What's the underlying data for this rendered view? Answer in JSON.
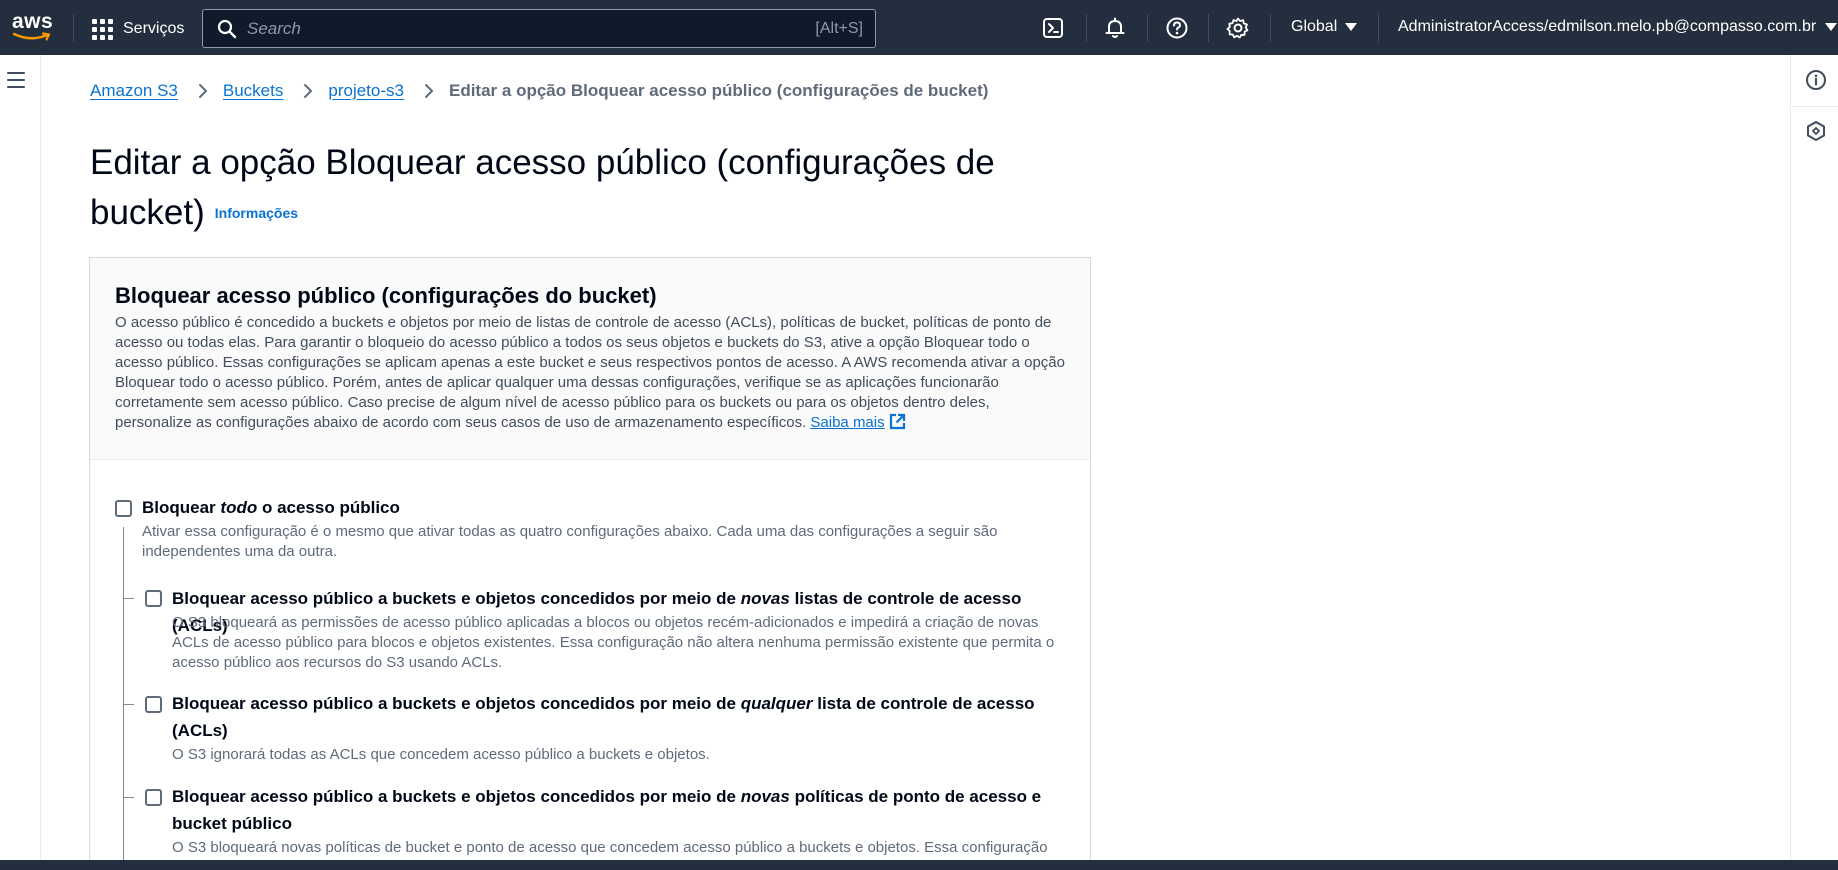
{
  "nav": {
    "logo_text": "aws",
    "services_label": "Serviços",
    "search_placeholder": "Search",
    "search_shortcut": "[Alt+S]",
    "region_label": "Global",
    "account_label": "AdministratorAccess/edmilson.melo.pb@compasso.com.br",
    "icons": [
      "cloudshell-icon",
      "notifications-icon",
      "help-icon",
      "settings-icon"
    ]
  },
  "breadcrumb": {
    "items": [
      "Amazon S3",
      "Buckets",
      "projeto-s3"
    ],
    "current": "Editar a opção Bloquear acesso público (configurações de bucket)"
  },
  "page": {
    "title": "Editar a opção Bloquear acesso público (configurações de bucket)",
    "info_link": "Informações"
  },
  "panel": {
    "title": "Bloquear acesso público (configurações do bucket)",
    "description": "O acesso público é concedido a buckets e objetos por meio de listas de controle de acesso (ACLs), políticas de bucket, políticas de ponto de acesso ou todas elas. Para garantir o bloqueio do acesso público a todos os seus objetos e buckets do S3, ative a opção Bloquear todo o acesso público. Essas configurações se aplicam apenas a este bucket e seus respectivos pontos de acesso. A AWS recomenda ativar a opção Bloquear todo o acesso público. Porém, antes de aplicar qualquer uma dessas configurações, verifique se as aplicações funcionarão corretamente sem acesso público. Caso precise de algum nível de acesso público para os buckets ou para os objetos dentro deles, personalize as configurações abaixo de acordo com seus casos de uso de armazenamento específicos.",
    "learn_more": "Saiba mais"
  },
  "options": {
    "all": {
      "label_before": "Bloquear ",
      "label_em": "todo",
      "label_after": " o acesso público",
      "description": "Ativar essa configuração é o mesmo que ativar todas as quatro configurações abaixo. Cada uma das configurações a seguir são independentes uma da outra.",
      "checked": false
    },
    "new_acls": {
      "label_before": "Bloquear acesso público a buckets e objetos concedidos por meio de ",
      "label_em": "novas",
      "label_after": " listas de controle de acesso (ACLs)",
      "description": "O S3 bloqueará as permissões de acesso público aplicadas a blocos ou objetos recém-adicionados e impedirá a criação de novas ACLs de acesso público para blocos e objetos existentes. Essa configuração não altera nenhuma permissão existente que permita o acesso público aos recursos do S3 usando ACLs.",
      "checked": false
    },
    "any_acls": {
      "label_before": "Bloquear acesso público a buckets e objetos concedidos por meio de ",
      "label_em": "qualquer",
      "label_after": " lista de controle de acesso (ACLs)",
      "description": "O S3 ignorará todas as ACLs que concedem acesso público a buckets e objetos.",
      "checked": false
    },
    "new_policies": {
      "label_before": "Bloquear acesso público a buckets e objetos concedidos por meio de ",
      "label_em": "novas",
      "label_after": " políticas de ponto de acesso e bucket público",
      "description": "O S3 bloqueará novas políticas de bucket e ponto de acesso que concedem acesso público a buckets e objetos. Essa configuração",
      "checked": false
    }
  }
}
